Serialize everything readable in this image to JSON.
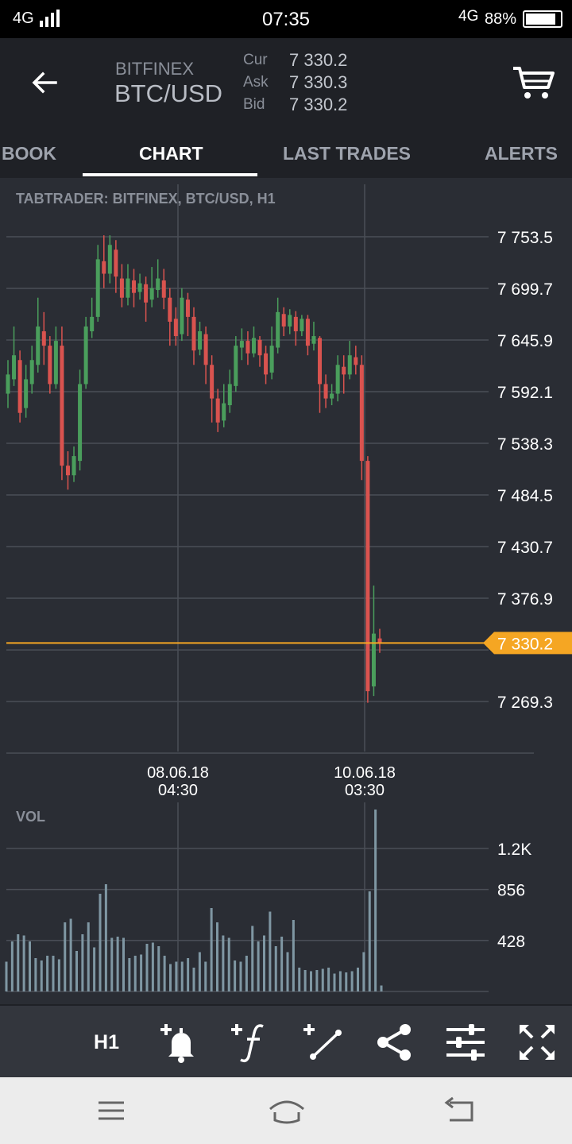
{
  "status_bar": {
    "network_left": "4G",
    "time": "07:35",
    "network_right": "4G",
    "battery": "88%"
  },
  "header": {
    "exchange": "BITFINEX",
    "pair": "BTC/USD",
    "quotes": [
      {
        "label": "Cur",
        "value": "7 330.2"
      },
      {
        "label": "Ask",
        "value": "7 330.3"
      },
      {
        "label": "Bid",
        "value": "7 330.2"
      }
    ]
  },
  "tabs": [
    {
      "label": "BOOK",
      "active": false
    },
    {
      "label": "CHART",
      "active": true
    },
    {
      "label": "LAST TRADES",
      "active": false
    },
    {
      "label": "ALERTS",
      "active": false
    }
  ],
  "chart": {
    "title": "TABTRADER: BITFINEX, BTC/USD, H1",
    "price_ticks": [
      "7 753.5",
      "7 699.7",
      "7 645.9",
      "7 592.1",
      "7 538.3",
      "7 484.5",
      "7 430.7",
      "7 376.9",
      "7 269.3"
    ],
    "current_price_label": "7 330.2",
    "time_labels": [
      {
        "date": "08.06.18",
        "time": "04:30"
      },
      {
        "date": "10.06.18",
        "time": "03:30"
      }
    ],
    "volume_title": "VOL",
    "volume_ticks": [
      "1.2K",
      "856",
      "428"
    ],
    "colors": {
      "up": "#4a9e5c",
      "down": "#d9534f",
      "price_line": "#f5a623",
      "grid": "#4a4e57",
      "volume": "#7f97a3"
    }
  },
  "chart_data": {
    "type": "candlestick",
    "title": "TABTRADER: BITFINEX, BTC/USD, H1",
    "y_ticks": [
      7753.5,
      7699.7,
      7645.9,
      7592.1,
      7538.3,
      7484.5,
      7430.7,
      7376.9,
      7269.3
    ],
    "x_ticks": [
      "08.06.18 04:30",
      "10.06.18 03:30"
    ],
    "current_price": 7330.2,
    "ylim": [
      7215.5,
      7775
    ],
    "candles": [
      [
        7590,
        7610,
        7575,
        7625
      ],
      [
        7605,
        7630,
        7598,
        7660
      ],
      [
        7625,
        7570,
        7560,
        7635
      ],
      [
        7575,
        7605,
        7565,
        7620
      ],
      [
        7600,
        7625,
        7590,
        7640
      ],
      [
        7620,
        7660,
        7612,
        7690
      ],
      [
        7655,
        7640,
        7620,
        7675
      ],
      [
        7640,
        7600,
        7590,
        7650
      ],
      [
        7600,
        7645,
        7595,
        7660
      ],
      [
        7640,
        7515,
        7500,
        7660
      ],
      [
        7515,
        7505,
        7490,
        7530
      ],
      [
        7505,
        7525,
        7498,
        7535
      ],
      [
        7520,
        7600,
        7510,
        7615
      ],
      [
        7600,
        7660,
        7595,
        7670
      ],
      [
        7655,
        7670,
        7648,
        7690
      ],
      [
        7670,
        7730,
        7665,
        7745
      ],
      [
        7728,
        7715,
        7700,
        7755
      ],
      [
        7715,
        7745,
        7705,
        7755
      ],
      [
        7740,
        7712,
        7695,
        7750
      ],
      [
        7710,
        7690,
        7680,
        7725
      ],
      [
        7690,
        7710,
        7682,
        7725
      ],
      [
        7708,
        7695,
        7680,
        7720
      ],
      [
        7696,
        7705,
        7688,
        7715
      ],
      [
        7704,
        7685,
        7665,
        7712
      ],
      [
        7688,
        7700,
        7680,
        7722
      ],
      [
        7698,
        7710,
        7690,
        7730
      ],
      [
        7708,
        7690,
        7678,
        7720
      ],
      [
        7690,
        7665,
        7640,
        7700
      ],
      [
        7668,
        7650,
        7640,
        7680
      ],
      [
        7652,
        7690,
        7645,
        7700
      ],
      [
        7688,
        7670,
        7650,
        7695
      ],
      [
        7670,
        7635,
        7620,
        7680
      ],
      [
        7636,
        7655,
        7630,
        7665
      ],
      [
        7652,
        7620,
        7600,
        7660
      ],
      [
        7620,
        7585,
        7560,
        7630
      ],
      [
        7585,
        7560,
        7550,
        7595
      ],
      [
        7562,
        7580,
        7555,
        7600
      ],
      [
        7578,
        7600,
        7570,
        7615
      ],
      [
        7598,
        7640,
        7592,
        7650
      ],
      [
        7638,
        7645,
        7625,
        7658
      ],
      [
        7645,
        7632,
        7620,
        7655
      ],
      [
        7632,
        7648,
        7628,
        7660
      ],
      [
        7646,
        7630,
        7618,
        7650
      ],
      [
        7632,
        7610,
        7600,
        7640
      ],
      [
        7612,
        7640,
        7605,
        7660
      ],
      [
        7638,
        7675,
        7632,
        7690
      ],
      [
        7673,
        7660,
        7650,
        7680
      ],
      [
        7660,
        7672,
        7652,
        7678
      ],
      [
        7670,
        7655,
        7640,
        7676
      ],
      [
        7655,
        7668,
        7650,
        7672
      ],
      [
        7668,
        7640,
        7630,
        7672
      ],
      [
        7642,
        7650,
        7635,
        7665
      ],
      [
        7648,
        7600,
        7570,
        7650
      ],
      [
        7600,
        7585,
        7575,
        7610
      ],
      [
        7585,
        7590,
        7578,
        7600
      ],
      [
        7590,
        7620,
        7582,
        7630
      ],
      [
        7618,
        7610,
        7590,
        7630
      ],
      [
        7610,
        7630,
        7605,
        7645
      ],
      [
        7628,
        7620,
        7610,
        7640
      ],
      [
        7620,
        7520,
        7500,
        7630
      ],
      [
        7520,
        7280,
        7268,
        7525
      ],
      [
        7285,
        7340,
        7275,
        7390
      ],
      [
        7335,
        7330,
        7320,
        7345
      ]
    ],
    "volume": {
      "title": "VOL",
      "y_ticks": [
        1200,
        856,
        428
      ],
      "values": [
        250,
        420,
        480,
        470,
        420,
        280,
        260,
        300,
        300,
        270,
        580,
        610,
        340,
        480,
        580,
        370,
        820,
        900,
        450,
        460,
        450,
        280,
        300,
        310,
        400,
        410,
        380,
        300,
        230,
        250,
        250,
        280,
        200,
        330,
        250,
        700,
        580,
        470,
        450,
        260,
        250,
        300,
        550,
        420,
        470,
        670,
        380,
        460,
        330,
        600,
        200,
        180,
        170,
        180,
        190,
        200,
        150,
        170,
        160,
        170,
        200,
        330,
        840,
        1830,
        50
      ]
    }
  },
  "toolbar": {
    "timeframe": "H1",
    "tools": [
      "add-alert-icon",
      "add-indicator-icon",
      "draw-line-icon",
      "share-icon",
      "settings-sliders-icon",
      "fullscreen-icon"
    ]
  }
}
